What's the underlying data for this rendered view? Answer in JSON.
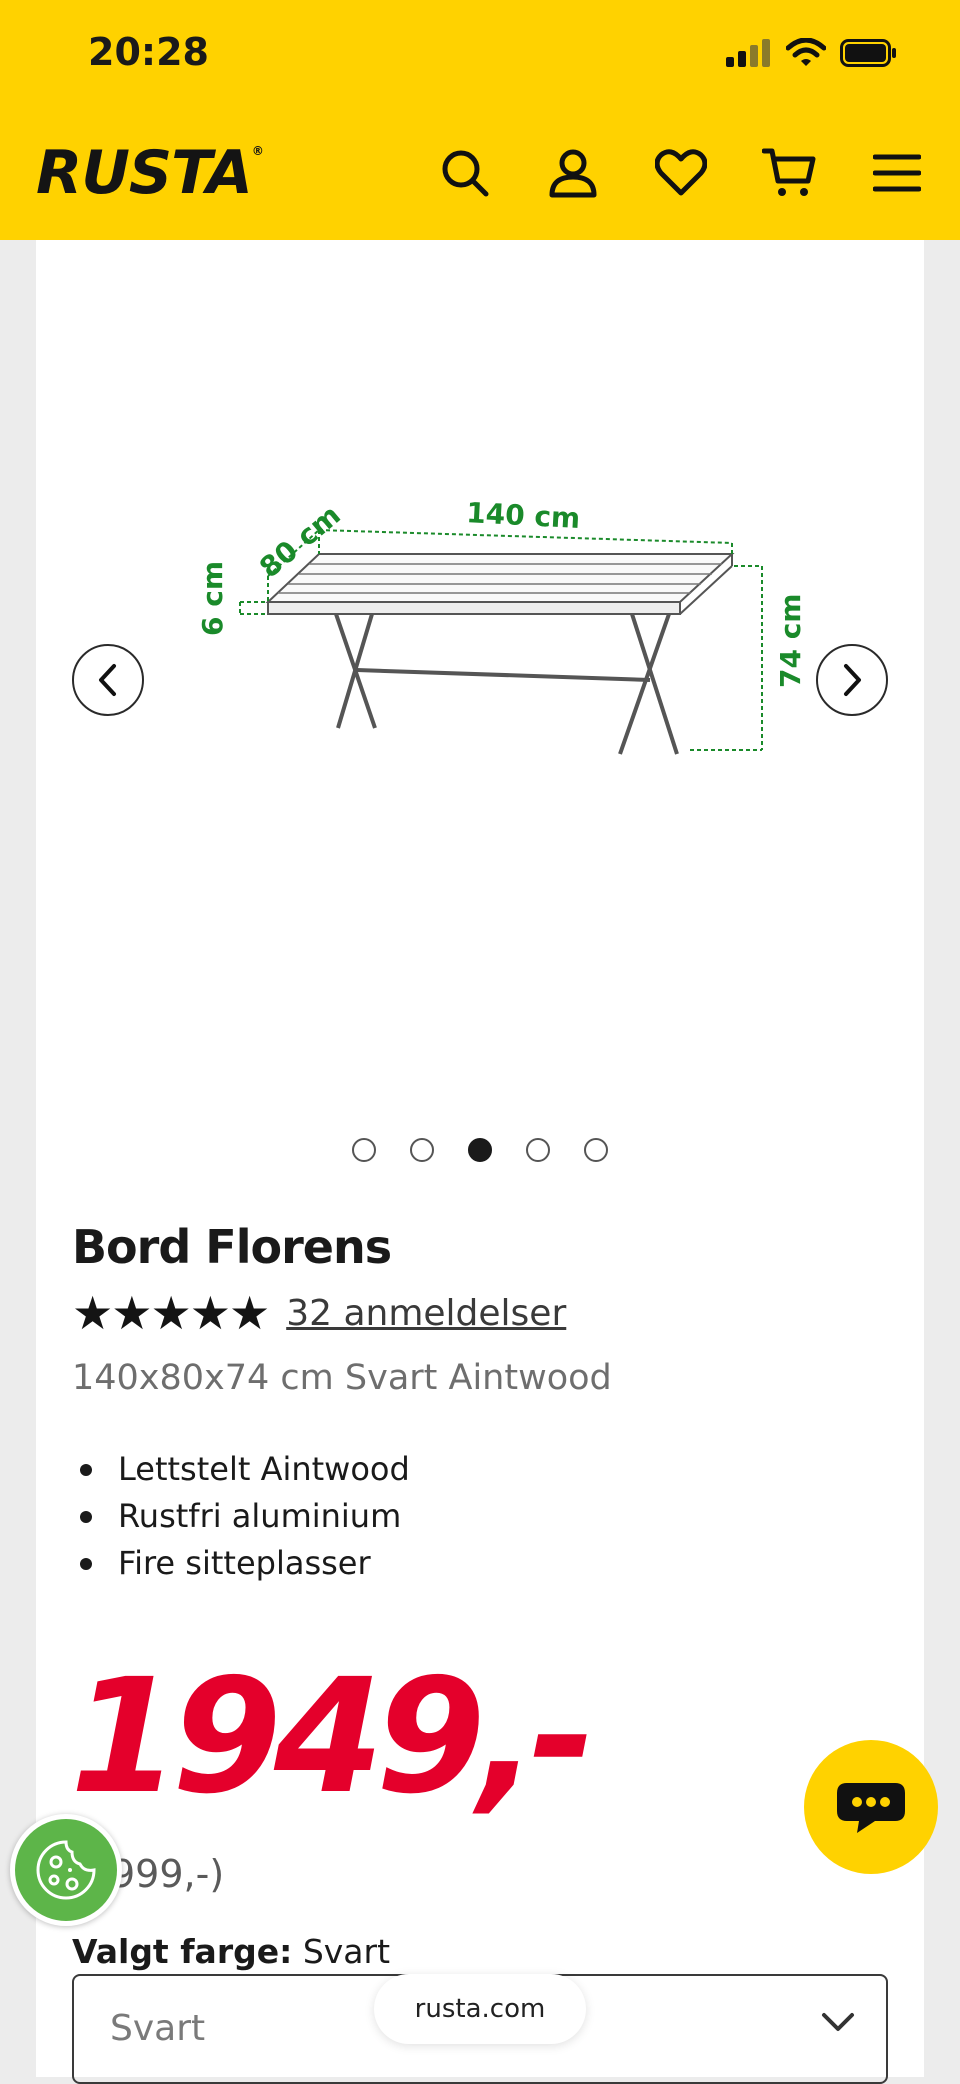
{
  "status_bar": {
    "time": "20:28"
  },
  "header": {
    "logo": "RUSTA",
    "logo_mark": "®",
    "icons": [
      "search-icon",
      "account-icon",
      "wishlist-heart-icon",
      "cart-icon",
      "menu-icon"
    ],
    "background": "#ffd200"
  },
  "gallery": {
    "image_labels": {
      "width": "140 cm",
      "depth": "80 cm",
      "height": "74 cm",
      "top_thickness": "6 cm"
    },
    "slide_count": 5,
    "active_slide_index": 2
  },
  "product": {
    "title": "Bord Florens",
    "rating_stars": "★★★★★",
    "rating_value": 5,
    "reviews_text": "32 anmeldelser",
    "subtitle": "140x80x74 cm Svart Aintwood",
    "features": [
      "Lettstelt Aintwood",
      "Rustfri aluminium",
      "Fire sitteplasser"
    ],
    "price": "1949",
    "price_suffix": ",-",
    "price_color": "#e4002b",
    "old_price": "(2999,-)",
    "color_label": "Valgt farge:",
    "color_value": "Svart",
    "color_select_value": "Svart"
  },
  "browser": {
    "url": "rusta.com"
  }
}
